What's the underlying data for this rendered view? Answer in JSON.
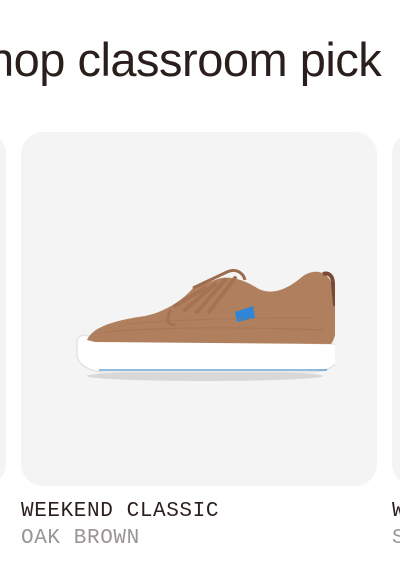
{
  "heading": "hop classroom pick",
  "products": [
    {
      "name": "WEEKEND CLASSIC",
      "color": "OAK BROWN",
      "image": "brown-knit-sneaker"
    },
    {
      "name": "W",
      "color": "S"
    }
  ],
  "colors": {
    "text": "#2a1f1c",
    "subtext": "#9a9594",
    "card_background": "#f4f4f4",
    "shoe_upper": "#b0805e",
    "shoe_sole": "#ffffff",
    "accent_tab": "#2f86d6"
  }
}
